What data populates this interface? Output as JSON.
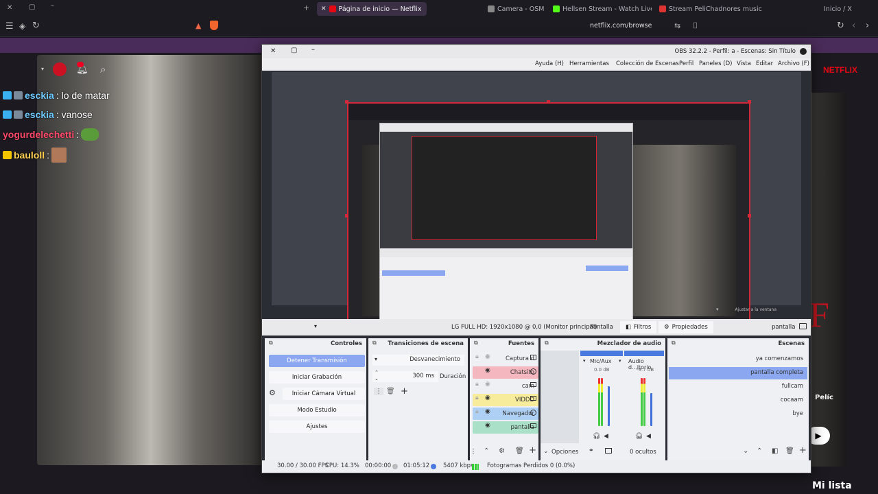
{
  "browser": {
    "tabs": [
      {
        "label": "Página de inicio — Netflix",
        "color": "#e50914"
      },
      {
        "label": "Hellsen Stream - Watch Live on K",
        "color": "#53fc18"
      },
      {
        "label": "Camera - OSM",
        "color": "#888888"
      },
      {
        "label": "Stream PeliChadnores music | Etc",
        "color": "#d33"
      },
      {
        "label": "Inicio / X",
        "color": "#888888"
      }
    ],
    "url": "netflix.com/browse"
  },
  "chat": {
    "messages": [
      {
        "user": "esckia",
        "text": ": lo de matar"
      },
      {
        "user": "esckia",
        "text": ": vanose"
      },
      {
        "user": "yogurdelechetti",
        "text": ":"
      },
      {
        "user": "bauloll",
        "text": ":"
      }
    ]
  },
  "netflix": {
    "logo": "NETFLIX",
    "mi_lista": "Mi lista",
    "peliculas": "Pelíc"
  },
  "obs": {
    "title": "OBS 32.2.2 - Perfil: a - Escenas: Sin Título",
    "menu": [
      "Archivo (F)",
      "Editar",
      "Vista",
      "Paneles (D)",
      "Perfil",
      "Colección de Escenas",
      "Herramientas",
      "Ayuda (H)"
    ],
    "preview_footer": "Ajustar a la ventana",
    "source_name": "pantalla",
    "properties_label": "Propiedades",
    "filters_label": "Filtros",
    "display_label": "Pantalla",
    "monitor_label": "LG FULL HD: 1920x1080 @ 0,0 (Monitor principal)",
    "docks": {
      "scenes": {
        "title": "Escenas",
        "items": [
          "ya comenzamos",
          "pantalla completa",
          "fullcam",
          "cocaam",
          "bye"
        ],
        "selected": 1
      },
      "mixer": {
        "title": "Mezclador de audio",
        "channels": [
          {
            "name": "Audio d...itorio",
            "db": "-9.7 dB"
          },
          {
            "name": "Mic/Aux",
            "db": "0.0 dB"
          }
        ],
        "hidden": "0 ocultos"
      },
      "sources": {
        "title": "Fuentes",
        "items": [
          {
            "name": "Captura d",
            "color": ""
          },
          {
            "name": "Chatsito",
            "color": "#f4b7c0"
          },
          {
            "name": "cam",
            "color": ""
          },
          {
            "name": "VIDDD",
            "color": "#f6ec9b"
          },
          {
            "name": "Navegador",
            "color": "#aed0f4"
          },
          {
            "name": "pantalla",
            "color": "#a9e0c7"
          }
        ],
        "options": "Opciones"
      },
      "transitions": {
        "title": "Transiciones de escena",
        "type": "Desvanecimiento",
        "duration_label": "Duración",
        "duration_value": "300 ms"
      },
      "controls": {
        "title": "Controles",
        "buttons": [
          "Detener Transmisión",
          "Iniciar Grabación",
          "Iniciar Cámara Virtual",
          "Modo Estudio",
          "Ajustes"
        ]
      }
    },
    "status": {
      "dropped": "Fotogramas Perdidos 0 (0.0%)",
      "bitrate": "5407 kbps",
      "stream_time": "01:05:12",
      "rec_time": "00:00:00",
      "cpu": "CPU: 14.3%",
      "fps": "30.00 / 30.00 FPS"
    }
  },
  "colors": {
    "accent": "#8aa7f0",
    "capture_border": "#d3283a"
  }
}
